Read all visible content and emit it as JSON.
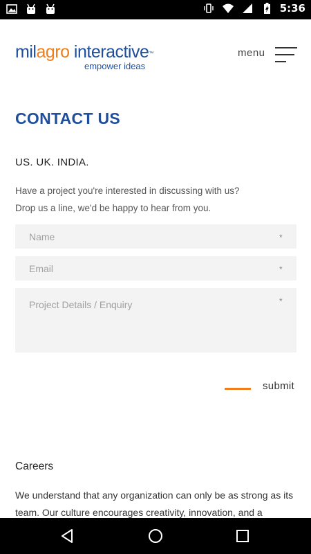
{
  "status_bar": {
    "time": "5:36",
    "left_icons": [
      "image-icon",
      "android-icon",
      "android-icon"
    ],
    "right_icons": [
      "vibrate-icon",
      "wifi-icon",
      "signal-icon",
      "battery-charging-icon"
    ]
  },
  "header": {
    "logo": {
      "part1": "mil",
      "part2": "agro",
      "part3": " interactive",
      "tm": "™",
      "tagline": "empower ideas"
    },
    "menu_label": "menu"
  },
  "colors": {
    "brand_blue": "#1f4f9c",
    "brand_orange": "#f07e1b",
    "field_bg": "#f3f3f3"
  },
  "contact": {
    "title": "CONTACT US",
    "locations": "US. UK. INDIA.",
    "intro_line1": "Have a project you're interested in discussing with us?",
    "intro_line2": "Drop us a line, we'd be happy to hear from you.",
    "name_placeholder": "Name",
    "email_placeholder": "Email",
    "project_placeholder": "Project Details / Enquiry",
    "required_marker": "*",
    "submit_label": "submit"
  },
  "careers": {
    "title": "Careers",
    "text": "We understand that any organization can only be as strong as its team. Our culture encourages creativity, innovation, and a"
  },
  "nav_bar": {
    "buttons": [
      "back-icon",
      "home-icon",
      "recents-icon"
    ]
  }
}
